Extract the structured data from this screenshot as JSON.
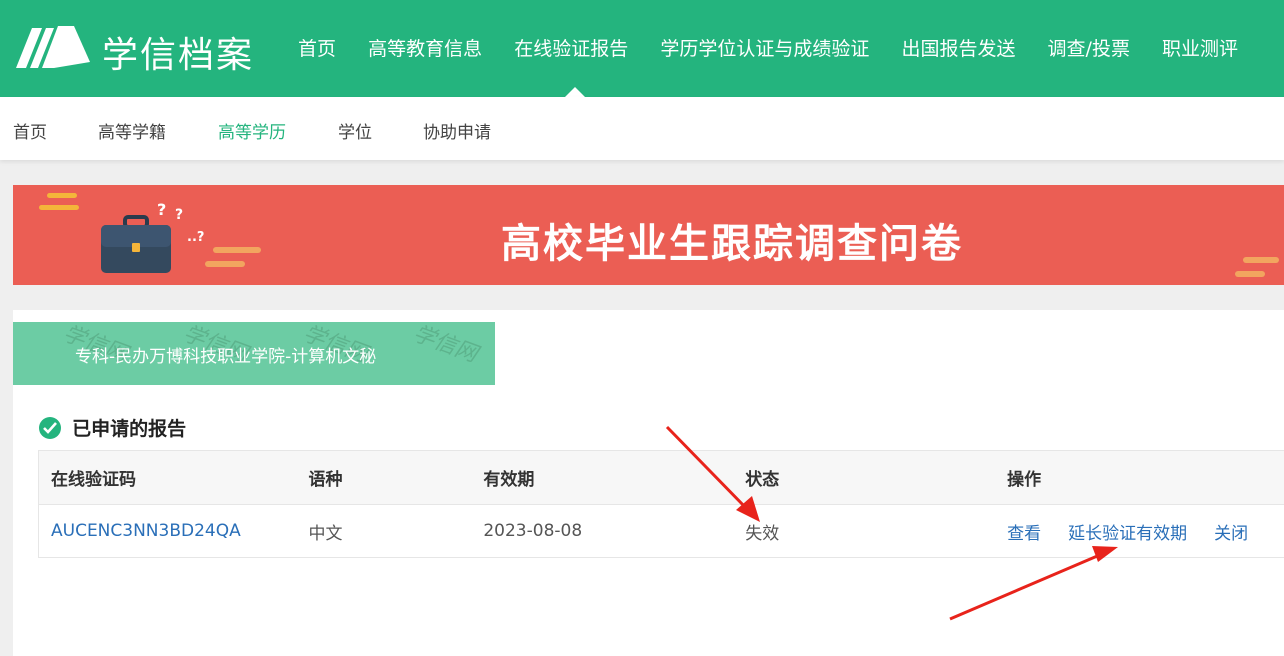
{
  "header": {
    "brand": "学信档案",
    "nav": [
      "首页",
      "高等教育信息",
      "在线验证报告",
      "学历学位认证与成绩验证",
      "出国报告发送",
      "调查/投票",
      "职业测评"
    ],
    "active_nav": "在线验证报告"
  },
  "subnav": {
    "items": [
      "首页",
      "高等学籍",
      "高等学历",
      "学位",
      "协助申请"
    ],
    "active": "高等学历"
  },
  "banner": {
    "title": "高校毕业生跟踪调查问卷"
  },
  "school": {
    "name": "专科-民办万博科技职业学院-计算机文秘"
  },
  "reports": {
    "section_title": "已申请的报告",
    "columns": [
      "在线验证码",
      "语种",
      "有效期",
      "状态",
      "操作"
    ],
    "rows": [
      {
        "code": "AUCENC3NN3BD24QA",
        "language": "中文",
        "expiry": "2023-08-08",
        "status": "失效",
        "actions": [
          "查看",
          "延长验证有效期",
          "关闭"
        ]
      }
    ]
  },
  "colors": {
    "brand_green": "#24b47e",
    "banner_red": "#eb5e54",
    "school_tab": "#6ccca4",
    "link_blue": "#2a6fb8",
    "annotation_red": "#e8231b"
  }
}
